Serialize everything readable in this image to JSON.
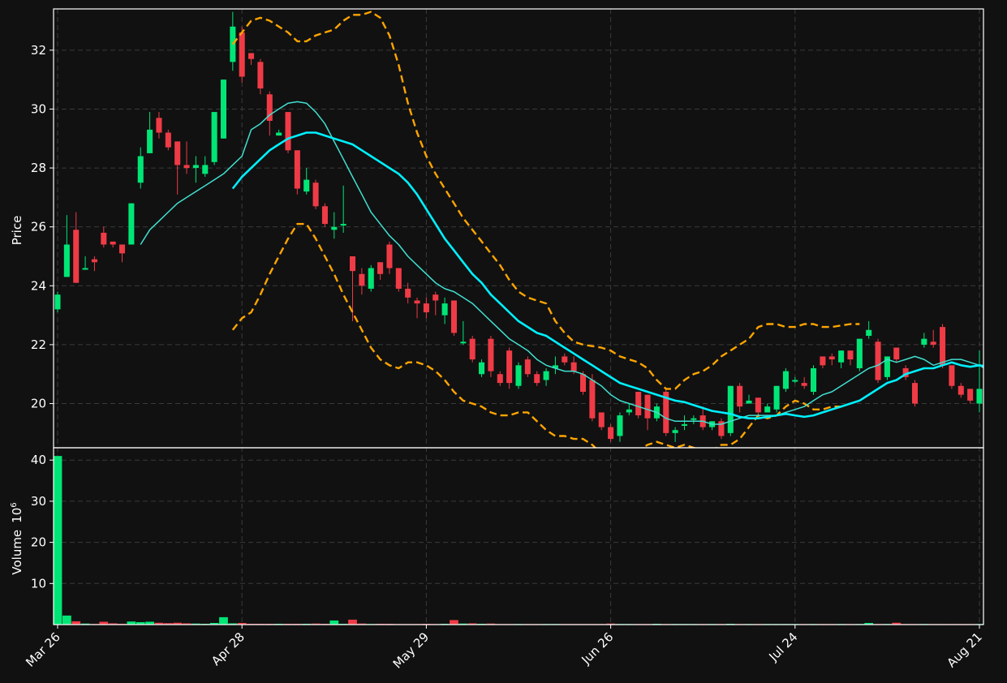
{
  "chart_data": {
    "type": "candlestick",
    "x_tick_labels": [
      "Mar 26",
      "Apr 28",
      "May 29",
      "Jun 26",
      "Jul 24",
      "Aug 21"
    ],
    "price_panel": {
      "ylabel": "Price",
      "yticks": [
        20,
        22,
        24,
        26,
        28,
        30,
        32
      ],
      "ylim": [
        18.5,
        33.4
      ]
    },
    "volume_panel": {
      "ylabel": "Volume",
      "ylabel_exponent": "6",
      "yticks": [
        10,
        20,
        30,
        40
      ],
      "ylim": [
        0,
        43
      ]
    },
    "colors": {
      "background": "#111111",
      "up": "#00e676",
      "down": "#ef3b46",
      "ma_short": "#40e0d0",
      "ma_long": "#00f0ff",
      "bollinger": "#ffa500",
      "grid": "#3a3a3a",
      "axis": "#ffffff"
    },
    "candles": [
      [
        23.2,
        23.7,
        23.1,
        23.8
      ],
      [
        24.3,
        25.4,
        24.3,
        26.4
      ],
      [
        25.9,
        24.1,
        24.1,
        26.5
      ],
      [
        24.6,
        24.6,
        24.6,
        25.0
      ],
      [
        24.9,
        24.8,
        24.5,
        25.0
      ],
      [
        25.8,
        25.4,
        25.3,
        26.0
      ],
      [
        25.5,
        25.4,
        25.3,
        25.5
      ],
      [
        25.4,
        25.1,
        24.8,
        25.4
      ],
      [
        25.4,
        26.8,
        25.4,
        26.8
      ],
      [
        27.5,
        28.4,
        27.3,
        28.7
      ],
      [
        28.5,
        29.3,
        28.5,
        29.9
      ],
      [
        29.7,
        29.2,
        29.0,
        29.9
      ],
      [
        29.2,
        28.7,
        28.6,
        29.3
      ],
      [
        28.9,
        28.1,
        27.1,
        28.9
      ],
      [
        28.1,
        28.0,
        27.8,
        28.9
      ],
      [
        28.0,
        28.1,
        27.5,
        28.4
      ],
      [
        27.8,
        28.1,
        27.7,
        28.4
      ],
      [
        28.2,
        29.9,
        28.1,
        29.9
      ],
      [
        29.0,
        31.0,
        29.0,
        31.0
      ],
      [
        31.6,
        32.8,
        31.3,
        33.3
      ],
      [
        32.6,
        31.1,
        30.9,
        32.8
      ],
      [
        31.9,
        31.7,
        31.5,
        31.9
      ],
      [
        31.6,
        30.7,
        30.5,
        31.7
      ],
      [
        30.5,
        29.6,
        29.1,
        30.6
      ],
      [
        29.1,
        29.2,
        29.1,
        29.3
      ],
      [
        29.9,
        28.6,
        28.5,
        29.9
      ],
      [
        28.6,
        27.3,
        27.1,
        28.6
      ],
      [
        27.2,
        27.6,
        27.1,
        28.0
      ],
      [
        27.5,
        26.7,
        26.6,
        27.6
      ],
      [
        26.7,
        26.1,
        26.0,
        26.8
      ],
      [
        25.9,
        26.0,
        25.6,
        26.5
      ],
      [
        26.1,
        26.1,
        25.8,
        27.4
      ],
      [
        25.0,
        24.5,
        22.8,
        25.0
      ],
      [
        24.4,
        24.0,
        23.7,
        24.6
      ],
      [
        23.9,
        24.6,
        23.8,
        24.7
      ],
      [
        24.8,
        24.4,
        24.2,
        24.8
      ],
      [
        25.4,
        24.6,
        24.4,
        25.5
      ],
      [
        24.6,
        23.9,
        23.8,
        24.6
      ],
      [
        23.9,
        23.6,
        23.4,
        24.1
      ],
      [
        23.5,
        23.4,
        22.9,
        23.6
      ],
      [
        23.4,
        23.1,
        22.9,
        23.6
      ],
      [
        23.7,
        23.5,
        23.0,
        23.8
      ],
      [
        23.0,
        23.4,
        22.7,
        23.6
      ],
      [
        23.5,
        22.4,
        22.3,
        23.5
      ],
      [
        22.1,
        22.1,
        22.0,
        22.8
      ],
      [
        22.2,
        21.5,
        21.4,
        22.3
      ],
      [
        21.0,
        21.4,
        20.9,
        21.5
      ],
      [
        22.2,
        21.1,
        20.9,
        22.3
      ],
      [
        21.0,
        20.7,
        20.6,
        21.1
      ],
      [
        21.8,
        20.7,
        20.5,
        21.9
      ],
      [
        20.6,
        21.3,
        20.5,
        21.4
      ],
      [
        21.5,
        21.0,
        20.9,
        21.6
      ],
      [
        21.0,
        20.7,
        20.6,
        21.1
      ],
      [
        20.8,
        21.1,
        20.6,
        21.2
      ],
      [
        21.2,
        21.3,
        21.0,
        21.6
      ],
      [
        21.6,
        21.4,
        21.3,
        21.7
      ],
      [
        21.4,
        21.1,
        21.0,
        21.6
      ],
      [
        21.0,
        20.4,
        20.3,
        21.1
      ],
      [
        20.8,
        19.5,
        19.4,
        21.0
      ],
      [
        19.7,
        19.2,
        19.1,
        19.7
      ],
      [
        19.2,
        18.8,
        18.7,
        19.3
      ],
      [
        18.9,
        19.6,
        18.7,
        19.7
      ],
      [
        19.7,
        19.8,
        19.6,
        20.0
      ],
      [
        20.4,
        19.6,
        19.5,
        20.4
      ],
      [
        20.3,
        19.5,
        19.1,
        20.3
      ],
      [
        19.5,
        19.9,
        19.4,
        20.0
      ],
      [
        20.4,
        19.0,
        18.9,
        20.5
      ],
      [
        19.0,
        19.1,
        18.7,
        19.2
      ],
      [
        19.3,
        19.3,
        19.1,
        19.6
      ],
      [
        19.5,
        19.5,
        19.3,
        19.6
      ],
      [
        19.6,
        19.2,
        19.1,
        19.9
      ],
      [
        19.2,
        19.4,
        19.1,
        19.4
      ],
      [
        19.4,
        18.9,
        18.8,
        19.5
      ],
      [
        19.0,
        20.6,
        18.9,
        20.6
      ],
      [
        20.6,
        19.9,
        19.7,
        20.7
      ],
      [
        20.0,
        20.1,
        20.0,
        20.3
      ],
      [
        20.2,
        19.7,
        19.6,
        20.2
      ],
      [
        19.7,
        19.9,
        19.7,
        20.0
      ],
      [
        19.8,
        20.6,
        19.7,
        20.6
      ],
      [
        20.5,
        21.1,
        20.4,
        21.2
      ],
      [
        20.8,
        20.8,
        20.7,
        20.9
      ],
      [
        20.7,
        20.6,
        20.5,
        20.9
      ],
      [
        20.4,
        21.2,
        20.3,
        21.3
      ],
      [
        21.6,
        21.3,
        21.2,
        21.6
      ],
      [
        21.6,
        21.5,
        21.3,
        21.7
      ],
      [
        21.4,
        21.8,
        21.2,
        21.8
      ],
      [
        21.8,
        21.5,
        21.3,
        21.8
      ],
      [
        21.2,
        22.2,
        21.1,
        22.2
      ],
      [
        22.3,
        22.5,
        22.2,
        22.8
      ],
      [
        22.1,
        20.8,
        20.7,
        22.2
      ],
      [
        20.9,
        21.6,
        20.8,
        21.6
      ],
      [
        21.9,
        21.5,
        21.4,
        21.9
      ],
      [
        21.2,
        20.9,
        20.8,
        21.3
      ],
      [
        20.7,
        20.0,
        19.9,
        20.8
      ],
      [
        22.0,
        22.2,
        21.9,
        22.4
      ],
      [
        22.1,
        22.0,
        21.9,
        22.5
      ],
      [
        22.6,
        21.3,
        21.2,
        22.7
      ],
      [
        21.3,
        20.6,
        20.5,
        21.3
      ],
      [
        20.6,
        20.3,
        20.2,
        20.7
      ],
      [
        20.5,
        20.1,
        20.0,
        20.5
      ],
      [
        20.0,
        20.5,
        19.7,
        21.8
      ]
    ],
    "volume_millions": [
      41,
      2.2,
      0.8,
      0.25,
      0.15,
      0.7,
      0.3,
      0.2,
      0.75,
      0.6,
      0.7,
      0.45,
      0.35,
      0.45,
      0.3,
      0.25,
      0.2,
      0.4,
      1.8,
      0.3,
      0.4,
      0.2,
      0.2,
      0.2,
      0.2,
      0.2,
      0.2,
      0.2,
      0.25,
      0.2,
      1.0,
      0.2,
      1.2,
      0.25,
      0.15,
      0.2,
      0.2,
      0.15,
      0.15,
      0.15,
      0.2,
      0.15,
      0.2,
      1.1,
      0.25,
      0.3,
      0.2,
      0.25,
      0.15,
      0.15,
      0.15,
      0.15,
      0.15,
      0.15,
      0.15,
      0.15,
      0.15,
      0.15,
      0.15,
      0.15,
      0.25,
      0.15,
      0.15,
      0.15,
      0.15,
      0.2,
      0.15,
      0.15,
      0.15,
      0.15,
      0.15,
      0.15,
      0.15,
      0.2,
      0.15,
      0.15,
      0.15,
      0.15,
      0.15,
      0.15,
      0.15,
      0.15,
      0.15,
      0.15,
      0.15,
      0.15,
      0.15,
      0.15,
      0.4,
      0.15,
      0.15,
      0.45,
      0.15,
      0.15,
      0.15,
      0.15,
      0.15,
      0.15,
      0.15,
      0.15,
      0.15,
      0.2
    ],
    "ma_short": [
      null,
      null,
      null,
      null,
      null,
      null,
      null,
      null,
      null,
      25.4,
      25.9,
      26.2,
      26.5,
      26.8,
      27.0,
      27.2,
      27.4,
      27.6,
      27.8,
      28.1,
      28.4,
      29.3,
      29.5,
      29.8,
      30.0,
      30.2,
      30.25,
      30.2,
      29.9,
      29.5,
      28.9,
      28.3,
      27.7,
      27.1,
      26.5,
      26.1,
      25.7,
      25.4,
      25.0,
      24.7,
      24.4,
      24.1,
      23.9,
      23.8,
      23.6,
      23.4,
      23.1,
      22.8,
      22.5,
      22.2,
      22.0,
      21.8,
      21.5,
      21.3,
      21.2,
      21.1,
      21.1,
      21.0,
      20.8,
      20.6,
      20.3,
      20.1,
      20.0,
      19.9,
      19.8,
      19.7,
      19.5,
      19.4,
      19.4,
      19.4,
      19.4,
      19.3,
      19.3,
      19.4,
      19.5,
      19.6,
      19.6,
      19.6,
      19.6,
      19.7,
      19.8,
      19.9,
      20.1,
      20.3,
      20.4,
      20.6,
      20.8,
      21.0,
      21.2,
      21.3,
      21.5,
      21.4,
      21.5,
      21.6,
      21.5,
      21.3,
      21.4,
      21.5,
      21.5,
      21.4,
      21.3,
      21.1,
      21.0
    ],
    "ma_long": [
      null,
      null,
      null,
      null,
      null,
      null,
      null,
      null,
      null,
      null,
      null,
      null,
      null,
      null,
      null,
      null,
      null,
      null,
      null,
      27.3,
      27.7,
      28.0,
      28.3,
      28.6,
      28.8,
      29.0,
      29.1,
      29.2,
      29.2,
      29.1,
      29.0,
      28.9,
      28.8,
      28.6,
      28.4,
      28.2,
      28.0,
      27.8,
      27.5,
      27.1,
      26.6,
      26.1,
      25.6,
      25.2,
      24.8,
      24.4,
      24.1,
      23.7,
      23.4,
      23.1,
      22.8,
      22.6,
      22.4,
      22.3,
      22.1,
      21.9,
      21.7,
      21.5,
      21.3,
      21.1,
      20.9,
      20.7,
      20.6,
      20.5,
      20.4,
      20.3,
      20.2,
      20.1,
      20.05,
      19.95,
      19.85,
      19.75,
      19.7,
      19.65,
      19.55,
      19.5,
      19.5,
      19.55,
      19.6,
      19.65,
      19.6,
      19.55,
      19.6,
      19.7,
      19.8,
      19.9,
      20.0,
      20.1,
      20.3,
      20.5,
      20.7,
      20.8,
      21.0,
      21.1,
      21.2,
      21.2,
      21.3,
      21.4,
      21.3,
      21.25,
      21.3,
      21.25,
      21.2
    ],
    "bollinger_upper": [
      null,
      null,
      null,
      null,
      null,
      null,
      null,
      null,
      null,
      null,
      null,
      null,
      null,
      null,
      null,
      null,
      null,
      null,
      null,
      32.2,
      32.6,
      33.0,
      33.1,
      33.0,
      32.8,
      32.6,
      32.3,
      32.3,
      32.5,
      32.6,
      32.7,
      33.0,
      33.2,
      33.2,
      33.3,
      33.1,
      32.5,
      31.5,
      30.2,
      29.2,
      28.4,
      27.8,
      27.3,
      26.8,
      26.3,
      25.9,
      25.5,
      25.1,
      24.7,
      24.2,
      23.8,
      23.6,
      23.5,
      23.4,
      22.8,
      22.4,
      22.1,
      22.0,
      21.95,
      21.9,
      21.8,
      21.6,
      21.5,
      21.4,
      21.2,
      20.8,
      20.5,
      20.5,
      20.8,
      21.0,
      21.1,
      21.3,
      21.6,
      21.8,
      22.0,
      22.2,
      22.6,
      22.7,
      22.7,
      22.6,
      22.6,
      22.7,
      22.7,
      22.6,
      22.6,
      22.65,
      22.7,
      22.7
    ],
    "bollinger_lower": [
      null,
      null,
      null,
      null,
      null,
      null,
      null,
      null,
      null,
      null,
      null,
      null,
      null,
      null,
      null,
      null,
      null,
      null,
      null,
      22.5,
      22.9,
      23.1,
      23.7,
      24.4,
      25.0,
      25.6,
      26.1,
      26.1,
      25.6,
      25.0,
      24.4,
      23.7,
      23.1,
      22.5,
      21.9,
      21.5,
      21.3,
      21.2,
      21.4,
      21.4,
      21.3,
      21.1,
      20.8,
      20.4,
      20.1,
      20.0,
      19.9,
      19.7,
      19.6,
      19.6,
      19.7,
      19.7,
      19.4,
      19.1,
      18.9,
      18.9,
      18.8,
      18.8,
      18.6,
      18.3,
      18.1,
      17.9,
      18.2,
      18.4,
      18.6,
      18.7,
      18.6,
      18.5,
      18.6,
      18.5,
      18.4,
      18.4,
      18.6,
      18.6,
      18.8,
      19.2,
      19.6,
      19.5,
      19.6,
      19.9,
      20.1,
      20.0,
      19.8,
      19.8,
      19.9,
      19.9
    ]
  }
}
